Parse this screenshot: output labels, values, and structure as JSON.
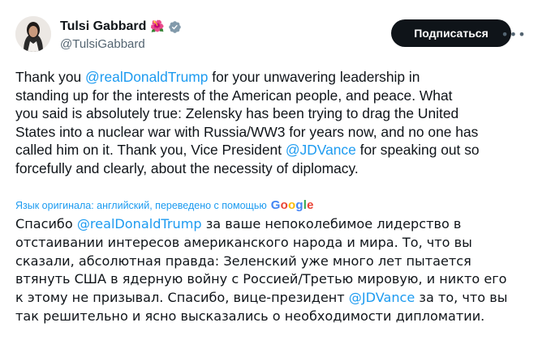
{
  "author": {
    "display_name": "Tulsi Gabbard",
    "handle": "@TulsiGabbard",
    "emoji_icon": "flower-icon",
    "verified_icon": "verified-badge-icon",
    "verified_color": "#829aab"
  },
  "actions": {
    "subscribe_label": "Подписаться",
    "more_label": "•••"
  },
  "tweet": {
    "segments": [
      {
        "text": "Thank you ",
        "type": "text"
      },
      {
        "text": "@realDonaldTrump",
        "type": "mention"
      },
      {
        "text": " for your unwavering leadership in\nstanding up for the interests of the American people, and peace. What\nyou said is absolutely true: Zelensky has been trying to drag the United\nStates into a nuclear war with Russia/WW3 for years now, and no one has\ncalled him on it. Thank you, Vice President ",
        "type": "text"
      },
      {
        "text": "@JDVance",
        "type": "mention"
      },
      {
        "text": " for speaking out so\nforcefully and clearly, about the necessity of diplomacy.",
        "type": "text"
      }
    ]
  },
  "translation": {
    "note": "Язык оригинала: английский, переведено с помощью",
    "provider": "Google",
    "segments": [
      {
        "text": "Спасибо ",
        "type": "text"
      },
      {
        "text": "@realDonaldTrump",
        "type": "mention"
      },
      {
        "text": " за ваше непоколебимое лидерство в\nотстаивании интересов американского народа и мира. То, что вы\nсказали, абсолютная правда: Зеленский уже много лет пытается\nвтянуть США в ядерную войну с Россией/Третью мировую, и никто его\nк этому не призывал. Спасибо, вице-президент ",
        "type": "text"
      },
      {
        "text": "@JDVance",
        "type": "mention"
      },
      {
        "text": " за то, что вы\nтак решительно и ясно высказались о необходимости дипломатии.",
        "type": "text"
      }
    ]
  },
  "colors": {
    "accent": "#1d9bf0",
    "text": "#0f1419",
    "secondary": "#536471",
    "button_bg": "#0f1419",
    "google_blue": "#4285f4",
    "google_red": "#ea4335",
    "google_yellow": "#fbbc05",
    "google_green": "#34a853"
  }
}
